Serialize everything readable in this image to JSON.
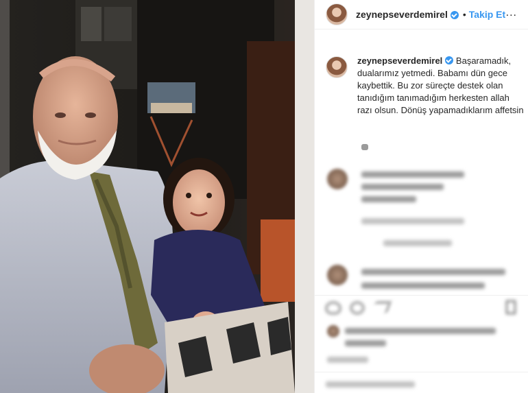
{
  "post": {
    "username": "zeynepseverdemirel",
    "follow_label": "Takip Et",
    "separator": "•",
    "more_label": "...",
    "caption": "Başaramadık, dualarımız yetmedi. Babamı dün gece kaybettik. Bu zor süreçte destek olan tanıdığım tanımadığım herkesten allah razı olsun. Dönüş yapamadıklarım affetsin"
  },
  "colors": {
    "link": "#3897f0",
    "text": "#262626",
    "divider": "#efefef"
  },
  "icons": [
    "verified-badge-icon",
    "more-options-icon",
    "heart-icon",
    "comment-icon",
    "share-icon",
    "bookmark-icon"
  ]
}
